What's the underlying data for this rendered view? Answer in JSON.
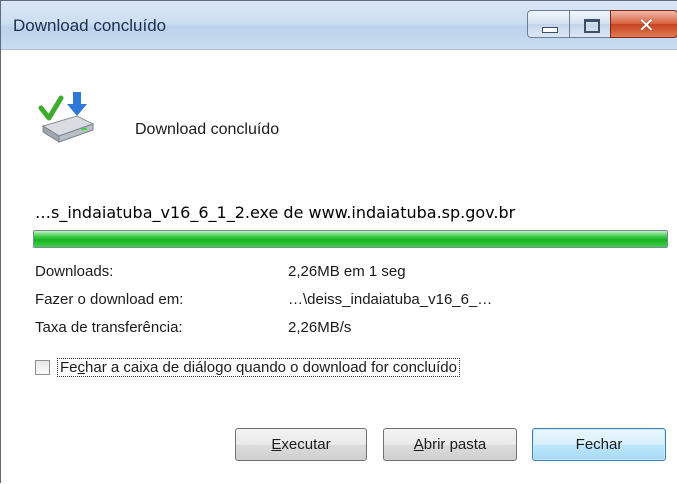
{
  "window": {
    "title": "Download concluído",
    "controls": {
      "minimize": "minimize",
      "maximize": "maximize",
      "close": "close"
    }
  },
  "header": {
    "icon": "drive-download-check-icon",
    "text": "Download concluído"
  },
  "file": {
    "description": "…s_indaiatuba_v16_6_1_2.exe de www.indaiatuba.sp.gov.br"
  },
  "progress": {
    "percent": 100,
    "color": "#17b422"
  },
  "info": {
    "downloads_label": "Downloads:",
    "downloads_value": "2,26MB em 1 seg",
    "path_label": "Fazer o download em:",
    "path_value": "…\\deiss_indaiatuba_v16_6_…",
    "rate_label": "Taxa de transferência:",
    "rate_value": "2,26MB/s"
  },
  "checkbox": {
    "checked": false,
    "label_pre": "Fe",
    "label_accel": "c",
    "label_post": "har a caixa de diálogo quando o download for concluído"
  },
  "buttons": {
    "run_accel": "E",
    "run_rest": "xecutar",
    "open_accel": "A",
    "open_rest": "brir pasta",
    "close": "Fechar"
  }
}
